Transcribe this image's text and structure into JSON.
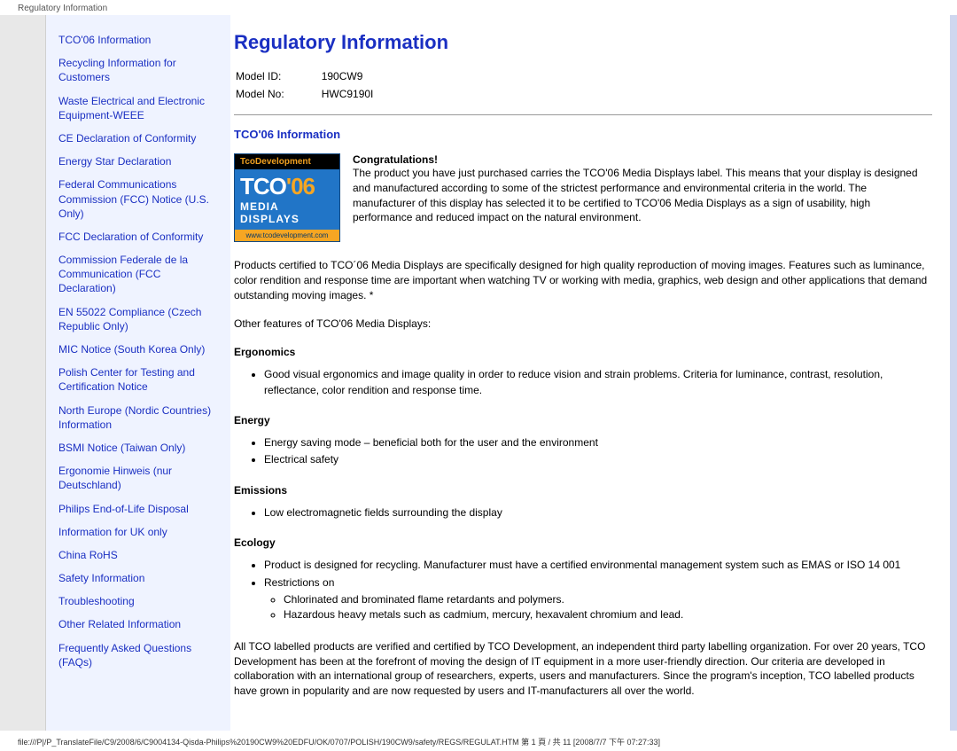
{
  "header": {
    "title": "Regulatory Information"
  },
  "sidebar": {
    "links": [
      "TCO'06 Information",
      "Recycling Information for Customers",
      "Waste Electrical and Electronic Equipment-WEEE",
      "CE Declaration of Conformity",
      "Energy Star Declaration",
      "Federal Communications Commission (FCC) Notice (U.S. Only)",
      "FCC Declaration of Conformity",
      "Commission Federale de la Communication (FCC Declaration)",
      "EN 55022 Compliance (Czech Republic Only)",
      "MIC Notice (South Korea Only)",
      "Polish Center for Testing and Certification Notice",
      "North Europe (Nordic Countries) Information",
      "BSMI Notice (Taiwan Only)",
      "Ergonomie Hinweis (nur Deutschland)",
      "Philips End-of-Life Disposal",
      "Information for UK only",
      "China RoHS",
      "Safety Information",
      "Troubleshooting",
      "Other Related Information",
      "Frequently Asked Questions (FAQs)"
    ]
  },
  "page": {
    "title": "Regulatory Information",
    "model_id_label": "Model ID:",
    "model_id_value": "190CW9",
    "model_no_label": "Model No:",
    "model_no_value": "HWC9190I",
    "section_title": "TCO'06 Information",
    "badge": {
      "top": "TcoDevelopment",
      "mid_pre": "TCO",
      "mid_orange": "'06",
      "sub": "MEDIA DISPLAYS",
      "url": "www.tcodevelopment.com"
    },
    "congrats_head": "Congratulations!",
    "congrats_body": "The product you have just purchased carries the TCO'06 Media Displays label. This means that your display is designed and manufactured according to some of the strictest performance and environmental criteria in the world. The manufacturer of this display has selected it to be certified to TCO'06 Media Displays as a sign of usability, high performance and reduced impact on the natural environment.",
    "para1": "Products certified to TCO´06 Media Displays are specifically designed for high quality reproduction of moving images. Features such as luminance, color rendition and response time are important when watching TV or working with media, graphics, web design and other applications that demand outstanding moving images. *",
    "para2": "Other features of TCO'06 Media Displays:",
    "ergonomics_head": "Ergonomics",
    "ergonomics_li1": "Good visual ergonomics and image quality in order to reduce vision and strain problems. Criteria for luminance, contrast, resolution, reflectance, color rendition and response time.",
    "energy_head": "Energy",
    "energy_li1": "Energy saving mode – beneficial both for the user and the environment",
    "energy_li2": "Electrical safety",
    "emissions_head": "Emissions",
    "emissions_li1": "Low electromagnetic fields surrounding the display",
    "ecology_head": "Ecology",
    "ecology_li1": "Product is designed for recycling. Manufacturer must have a certified environmental management system such as EMAS or ISO 14 001",
    "ecology_li2": "Restrictions on",
    "ecology_sub1": "Chlorinated and brominated flame retardants and polymers.",
    "ecology_sub2": "Hazardous heavy metals such as cadmium, mercury, hexavalent chromium and lead.",
    "para3": "All TCO labelled products are verified and certified by TCO Development, an independent third party labelling organization. For over 20 years, TCO Development has been at the forefront of moving the design of IT equipment in a more user-friendly direction. Our criteria are developed in collaboration with an international group of researchers, experts, users and manufacturers. Since the program's inception, TCO labelled products have grown in popularity and are now requested by users and IT-manufacturers all over the world."
  },
  "footer": {
    "path": "file:///P|/P_TranslateFile/C9/2008/6/C9004134-Qisda-Philips%20190CW9%20EDFU/OK/0707/POLISH/190CW9/safety/REGS/REGULAT.HTM 第 1 頁 / 共 11  [2008/7/7 下午 07:27:33]"
  }
}
